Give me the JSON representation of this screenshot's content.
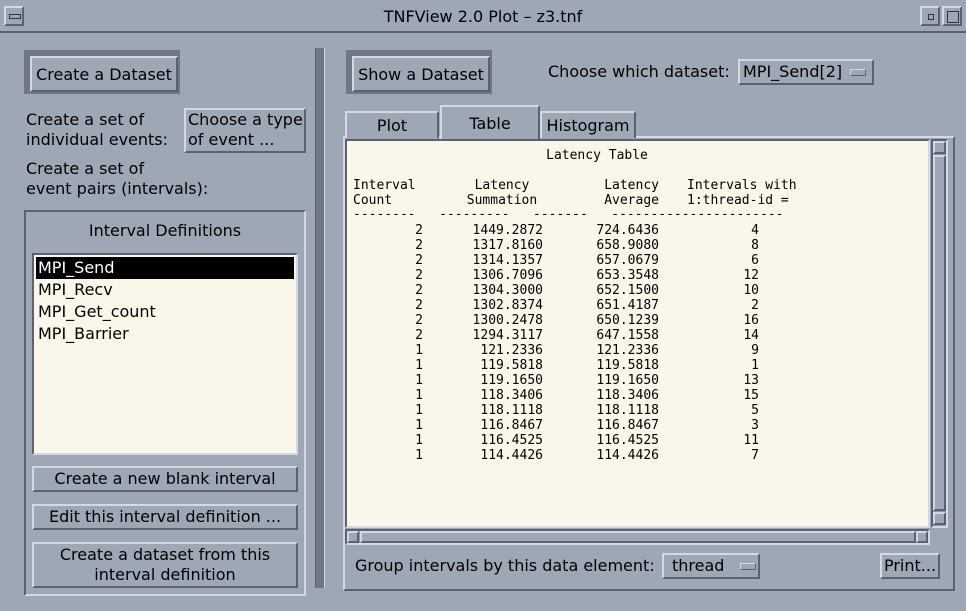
{
  "window": {
    "title": "TNFView 2.0 Plot – z3.tnf"
  },
  "left": {
    "create_dataset_label": "Create a Dataset",
    "create_set_events_label": "Create a set of\nindividual events:",
    "choose_type_label": "Choose a type\nof event ...",
    "create_pairs_label": "Create a set of\nevent pairs (intervals):",
    "interval_defs_title": "Interval Definitions",
    "intervals": [
      "MPI_Send",
      "MPI_Recv",
      "MPI_Get_count",
      "MPI_Barrier"
    ],
    "selected_interval": "MPI_Send",
    "new_blank_label": "Create a new blank interval",
    "edit_label": "Edit this interval definition ...",
    "create_from_def_label": "Create a dataset from this\ninterval definition"
  },
  "right": {
    "show_dataset_label": "Show a Dataset",
    "choose_dataset_label": "Choose which dataset:",
    "dataset_value": "MPI_Send[2]",
    "tabs": [
      "Plot",
      "Table",
      "Histogram"
    ],
    "active_tab": "Table",
    "group_label": "Group intervals by this data element:",
    "group_value": "thread",
    "print_label": "Print..."
  },
  "table": {
    "title": "Latency Table",
    "headers": [
      [
        "Interval",
        "Count"
      ],
      [
        "Latency",
        "Summation"
      ],
      [
        "Latency",
        "Average"
      ],
      [
        "Intervals with",
        "1:thread-id ="
      ]
    ],
    "rows": [
      [
        "2",
        "1449.2872",
        "724.6436",
        "4"
      ],
      [
        "2",
        "1317.8160",
        "658.9080",
        "8"
      ],
      [
        "2",
        "1314.1357",
        "657.0679",
        "6"
      ],
      [
        "2",
        "1306.7096",
        "653.3548",
        "12"
      ],
      [
        "2",
        "1304.3000",
        "652.1500",
        "10"
      ],
      [
        "2",
        "1302.8374",
        "651.4187",
        "2"
      ],
      [
        "2",
        "1300.2478",
        "650.1239",
        "16"
      ],
      [
        "2",
        "1294.3117",
        "647.1558",
        "14"
      ],
      [
        "1",
        "121.2336",
        "121.2336",
        "9"
      ],
      [
        "1",
        "119.5818",
        "119.5818",
        "1"
      ],
      [
        "1",
        "119.1650",
        "119.1650",
        "13"
      ],
      [
        "1",
        "118.3406",
        "118.3406",
        "15"
      ],
      [
        "1",
        "118.1118",
        "118.1118",
        "5"
      ],
      [
        "1",
        "116.8467",
        "116.8467",
        "3"
      ],
      [
        "1",
        "116.4525",
        "116.4525",
        "11"
      ],
      [
        "1",
        "114.4426",
        "114.4426",
        "7"
      ]
    ]
  },
  "colors": {
    "background": "#9da7b5",
    "panel": "#fbf6ea",
    "selection": "#000000"
  }
}
